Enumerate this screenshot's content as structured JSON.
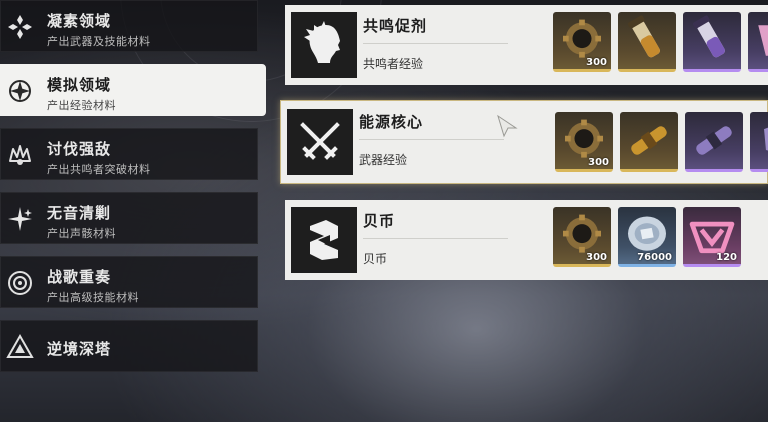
{
  "sidebar": {
    "items": [
      {
        "title": "凝素领域",
        "subtitle": "产出武器及技能材料",
        "icon": "diamond-cluster-icon",
        "active": false
      },
      {
        "title": "模拟领域",
        "subtitle": "产出经验材料",
        "icon": "compass-icon",
        "active": true
      },
      {
        "title": "讨伐强敌",
        "subtitle": "产出共鸣者突破材料",
        "icon": "crown-claw-icon",
        "active": false
      },
      {
        "title": "无音清剿",
        "subtitle": "产出声骸材料",
        "icon": "sparkle-icon",
        "active": false
      },
      {
        "title": "战歌重奏",
        "subtitle": "产出高级技能材料",
        "icon": "ring-emblem-icon",
        "active": false
      },
      {
        "title": "逆境深塔",
        "subtitle": "",
        "icon": "triangle-tower-icon",
        "active": false
      }
    ]
  },
  "rows": [
    {
      "title": "共鸣促剂",
      "subtitle": "共鸣者经验",
      "icon": "character-head-icon",
      "selected": false,
      "rewards": [
        {
          "icon": "gear-coin-icon",
          "qty": "300",
          "rarity": "gold"
        },
        {
          "icon": "vial-gold-icon",
          "qty": "",
          "rarity": "gold"
        },
        {
          "icon": "vial-purple-icon",
          "qty": "",
          "rarity": "purple"
        },
        {
          "icon": "crystal-partial-icon",
          "qty": "",
          "rarity": "purple"
        }
      ]
    },
    {
      "title": "能源核心",
      "subtitle": "武器经验",
      "icon": "crossed-swords-icon",
      "selected": true,
      "rewards": [
        {
          "icon": "gear-coin-icon",
          "qty": "300",
          "rarity": "gold"
        },
        {
          "icon": "energy-rod-gold-icon",
          "qty": "",
          "rarity": "gold"
        },
        {
          "icon": "energy-rod-purple-icon",
          "qty": "",
          "rarity": "purple"
        },
        {
          "icon": "crystal-partial-icon",
          "qty": "",
          "rarity": "purple"
        }
      ]
    },
    {
      "title": "贝币",
      "subtitle": "贝币",
      "icon": "shell-coin-logo-icon",
      "selected": false,
      "rewards": [
        {
          "icon": "gear-coin-icon",
          "qty": "300",
          "rarity": "gold"
        },
        {
          "icon": "shell-coin-icon",
          "qty": "76000",
          "rarity": "blue"
        },
        {
          "icon": "pink-emblem-icon",
          "qty": "120",
          "rarity": "purple"
        }
      ]
    }
  ],
  "colors": {
    "accent_gold": "#d9b75a",
    "accent_purple": "#b58cf0",
    "accent_blue": "#7fb2e5",
    "selected_border": "#c9b780"
  }
}
